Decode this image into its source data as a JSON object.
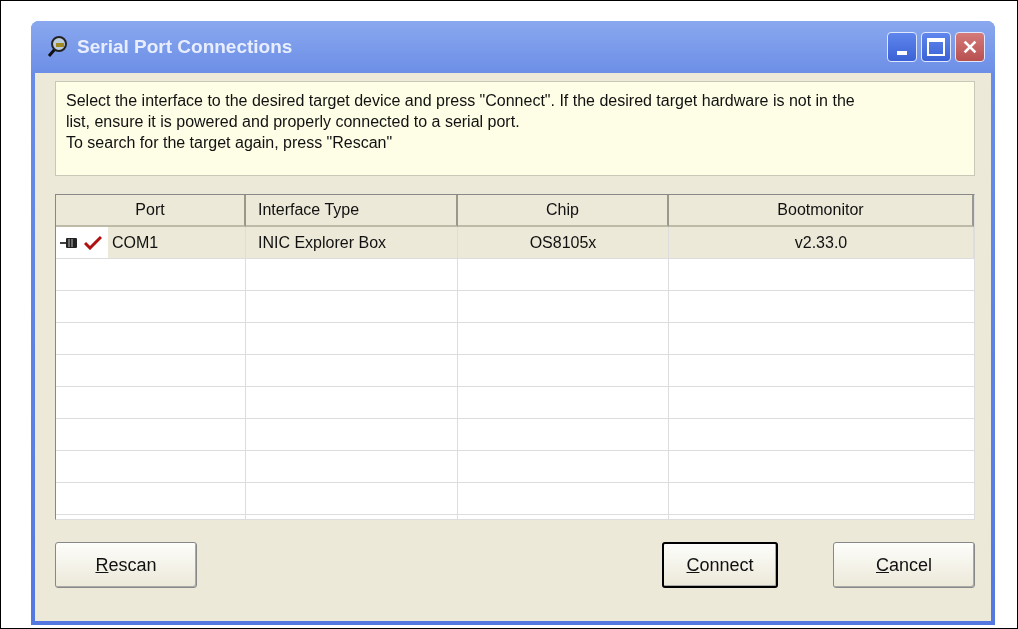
{
  "window": {
    "title": "Serial Port Connections"
  },
  "info": [
    "Select the interface to the desired target device and press \"Connect\". If the desired target hardware is not in the list, ensure it is powered and properly connected to a serial port.",
    "To search for the target again, press \"Rescan\""
  ],
  "table": {
    "columns": [
      "Port",
      "Interface Type",
      "Chip",
      "Bootmonitor"
    ],
    "rows": [
      {
        "port": "COM1",
        "interface_type": "INIC Explorer Box",
        "chip": "OS8105x",
        "bootmonitor": "v2.33.0",
        "selected": true,
        "verified": true
      }
    ]
  },
  "buttons": [
    {
      "label": "Rescan",
      "default": false,
      "underline_first": true
    },
    {
      "label": "Connect",
      "default": true,
      "underline_first": true
    },
    {
      "label": "Cancel",
      "default": false,
      "underline_first": true
    }
  ]
}
